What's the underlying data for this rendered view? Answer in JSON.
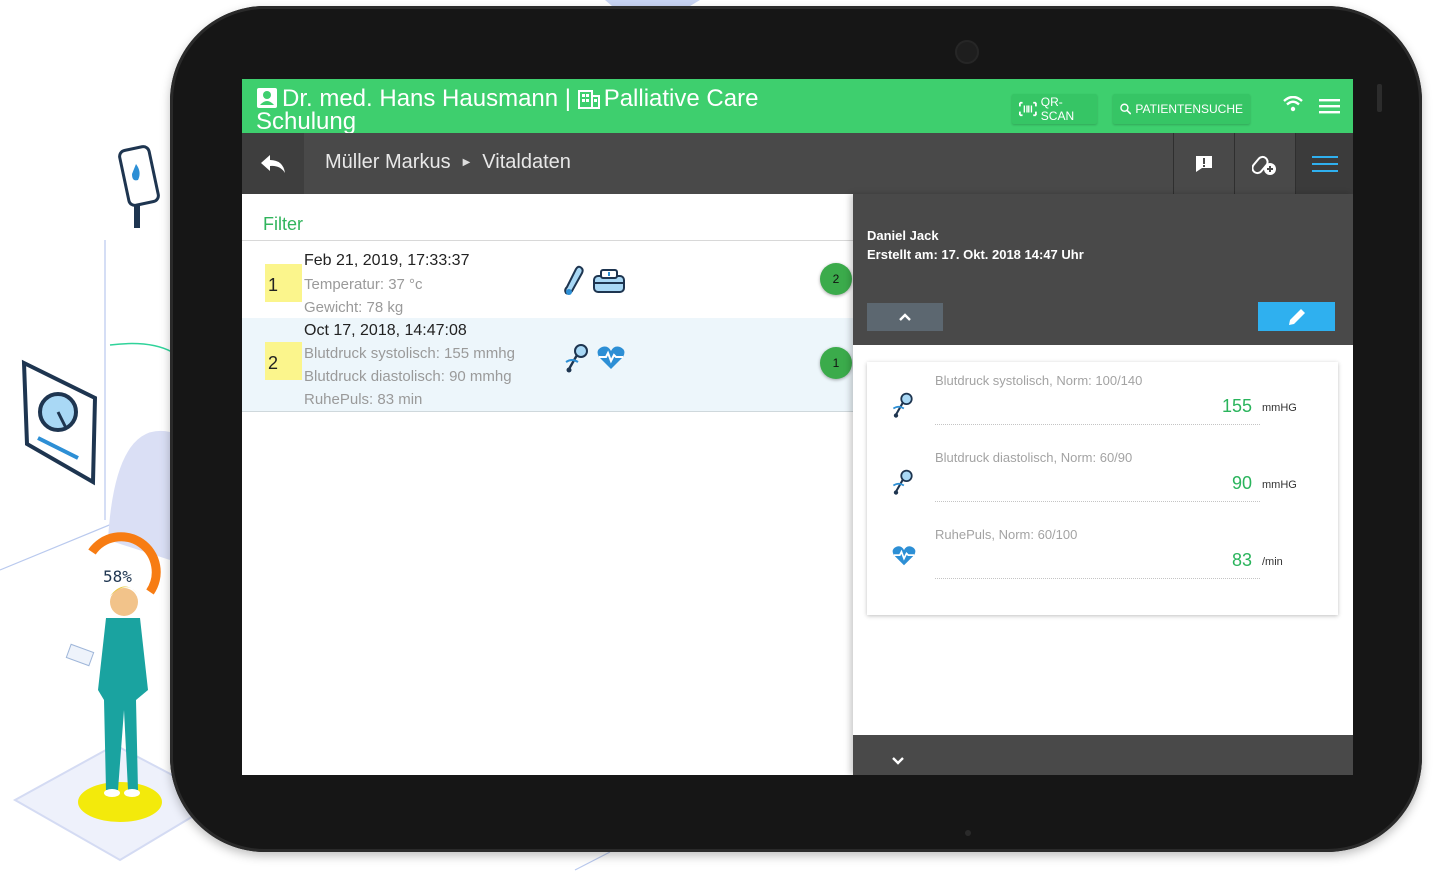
{
  "header": {
    "doctor": "Dr. med. Hans Hausmann | ",
    "unit": "Palliative Care",
    "unit_line2": "Schulung",
    "qr_label": "QR-SCAN",
    "search_label": "PATIENTENSUCHE"
  },
  "nav": {
    "patient": "Müller Markus",
    "section": "Vitaldaten"
  },
  "list": {
    "filter_label": "Filter",
    "entries": [
      {
        "index": "1",
        "date": "Feb 21, 2019, 17:33:37",
        "lines": [
          "Temperatur: 37 °c",
          "Gewicht: 78 kg"
        ],
        "icons": [
          "thermometer-icon",
          "scale-icon"
        ],
        "count": "2"
      },
      {
        "index": "2",
        "date": "Oct 17, 2018, 14:47:08",
        "lines": [
          "Blutdruck systolisch: 155 mmhg",
          "Blutdruck diastolisch: 90 mmhg",
          "RuhePuls: 83 min"
        ],
        "icons": [
          "stethoscope-icon",
          "heartbeat-icon"
        ],
        "count": "1"
      }
    ]
  },
  "detail": {
    "author": "Daniel Jack",
    "created": "Erstellt am: 17. Okt. 2018 14:47 Uhr",
    "vitals": [
      {
        "label": "Blutdruck systolisch, Norm: 100/140",
        "value": "155",
        "unit": "mmHG",
        "icon": "stethoscope-icon"
      },
      {
        "label": "Blutdruck diastolisch, Norm: 60/90",
        "value": "90",
        "unit": "mmHG",
        "icon": "stethoscope-icon"
      },
      {
        "label": "RuhePuls, Norm: 60/100",
        "value": "83",
        "unit": "/min",
        "icon": "heartbeat-icon"
      }
    ]
  },
  "decor": {
    "badge_text": "58%"
  },
  "colors": {
    "primary_green": "#3ecf6e",
    "dark_bar": "#494949",
    "edit_blue": "#2fb0ef",
    "value_green": "#2ab45c",
    "index_yellow": "#fbf58c"
  }
}
